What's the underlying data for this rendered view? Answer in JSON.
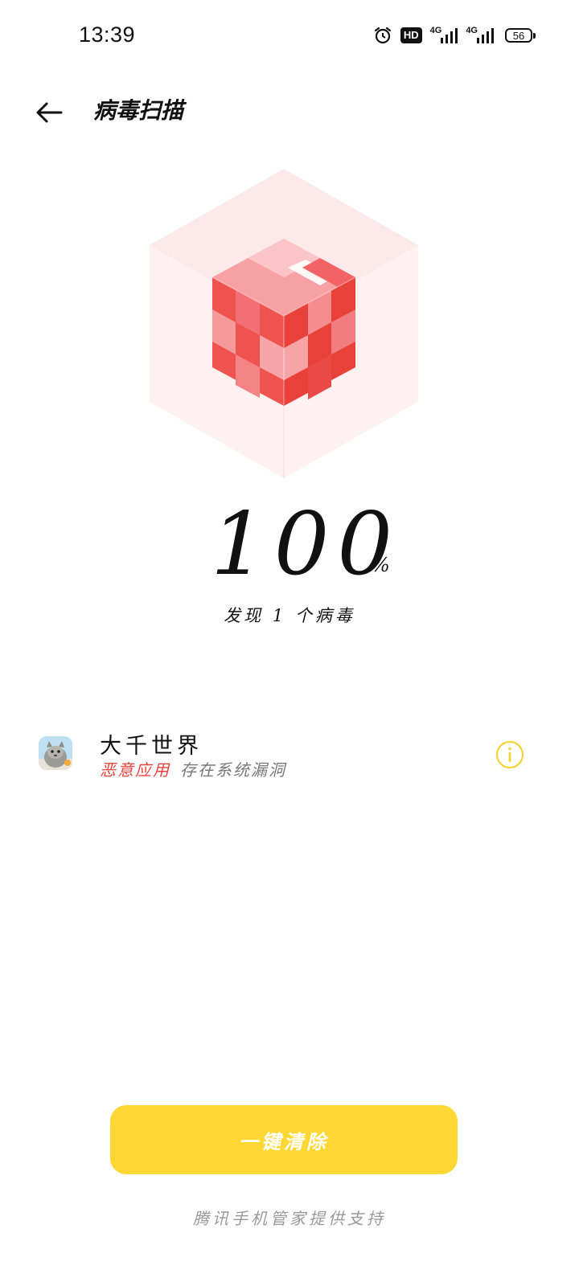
{
  "status_bar": {
    "time": "13:39",
    "hd_label": "HD",
    "network_1": "4G",
    "network_2": "4G",
    "battery": "56",
    "icons": [
      "alarm-icon",
      "hd-icon",
      "signal-icon",
      "signal-icon",
      "battery-icon"
    ]
  },
  "header": {
    "back_icon": "arrow-left-icon",
    "title": "病毒扫描"
  },
  "scan": {
    "progress_percent": 100,
    "progress_value": "100",
    "progress_unit": "%",
    "result_text": "发现 1 个病毒"
  },
  "threats": [
    {
      "app_name": "大千世界",
      "threat_type": "恶意应用",
      "threat_detail": "存在系统漏洞",
      "info_icon": "info-icon"
    }
  ],
  "actions": {
    "clean_label": "一键清除"
  },
  "footer": {
    "note": "腾讯手机管家提供支持"
  },
  "colors": {
    "accent_yellow": "#fdd835",
    "danger_red": "#e8413a",
    "info_yellow": "#f7d23a",
    "cube_red": "#ee4b48",
    "cube_light": "#f7a1a5"
  }
}
